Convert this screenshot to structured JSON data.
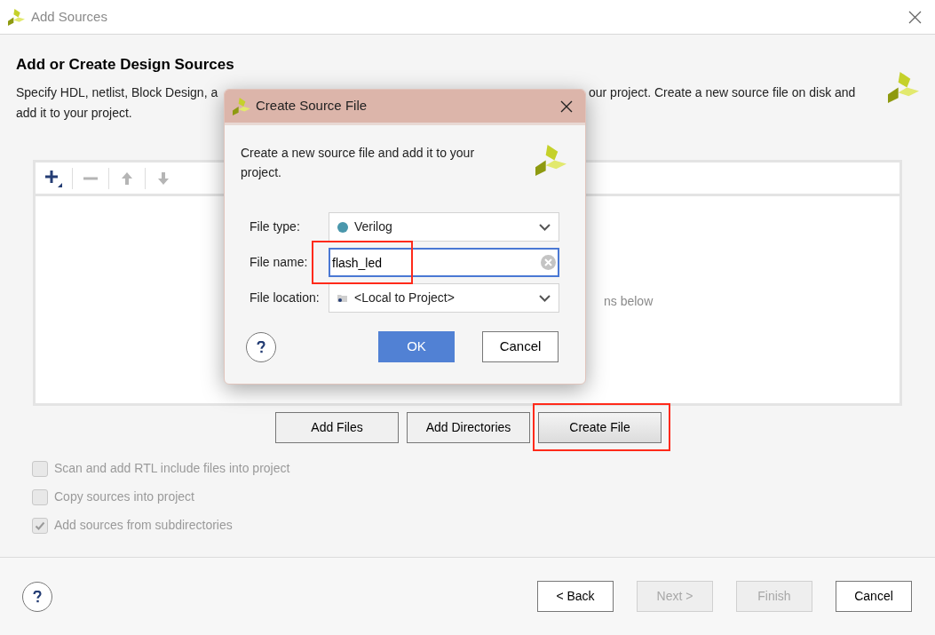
{
  "window": {
    "title": "Add Sources"
  },
  "header": {
    "title": "Add or Create Design Sources",
    "description_parts": [
      "Specify HDL, netlist, Block Design, a",
      "our project. Create a new source file on disk and",
      "add it to your project."
    ]
  },
  "toolbar": [
    {
      "kind": "add",
      "disabled": false
    },
    {
      "kind": "remove",
      "disabled": true
    },
    {
      "kind": "up",
      "disabled": true
    },
    {
      "kind": "down",
      "disabled": true
    }
  ],
  "list": {
    "hint": "ns below"
  },
  "source_buttons": [
    {
      "label": "Add Files",
      "annotated": false
    },
    {
      "label": "Add Directories",
      "annotated": false
    },
    {
      "label": "Create File",
      "annotated": true
    }
  ],
  "options": [
    {
      "label": "Scan and add RTL include files into project",
      "checked": false,
      "disabled": true
    },
    {
      "label": "Copy sources into project",
      "checked": false,
      "disabled": true
    },
    {
      "label": "Add sources from subdirectories",
      "checked": true,
      "disabled": true
    }
  ],
  "footer_buttons": [
    {
      "label": "< Back",
      "disabled": false
    },
    {
      "label": "Next >",
      "disabled": true
    },
    {
      "label": "Finish",
      "disabled": true
    },
    {
      "label": "Cancel",
      "disabled": false
    }
  ],
  "dialog": {
    "title": "Create Source File",
    "message": "Create a new source file and add it to your project.",
    "fields": [
      {
        "kind": "type_select",
        "label": "File type:",
        "value": "Verilog",
        "annotated": false
      },
      {
        "kind": "text",
        "label": "File name:",
        "value": "flash_led",
        "focused": true,
        "annotated": true
      },
      {
        "kind": "location_select",
        "label": "File location:",
        "value": "<Local to Project>",
        "annotated": false
      }
    ],
    "buttons": [
      {
        "label": "OK",
        "primary": true
      },
      {
        "label": "Cancel",
        "primary": false
      }
    ]
  }
}
